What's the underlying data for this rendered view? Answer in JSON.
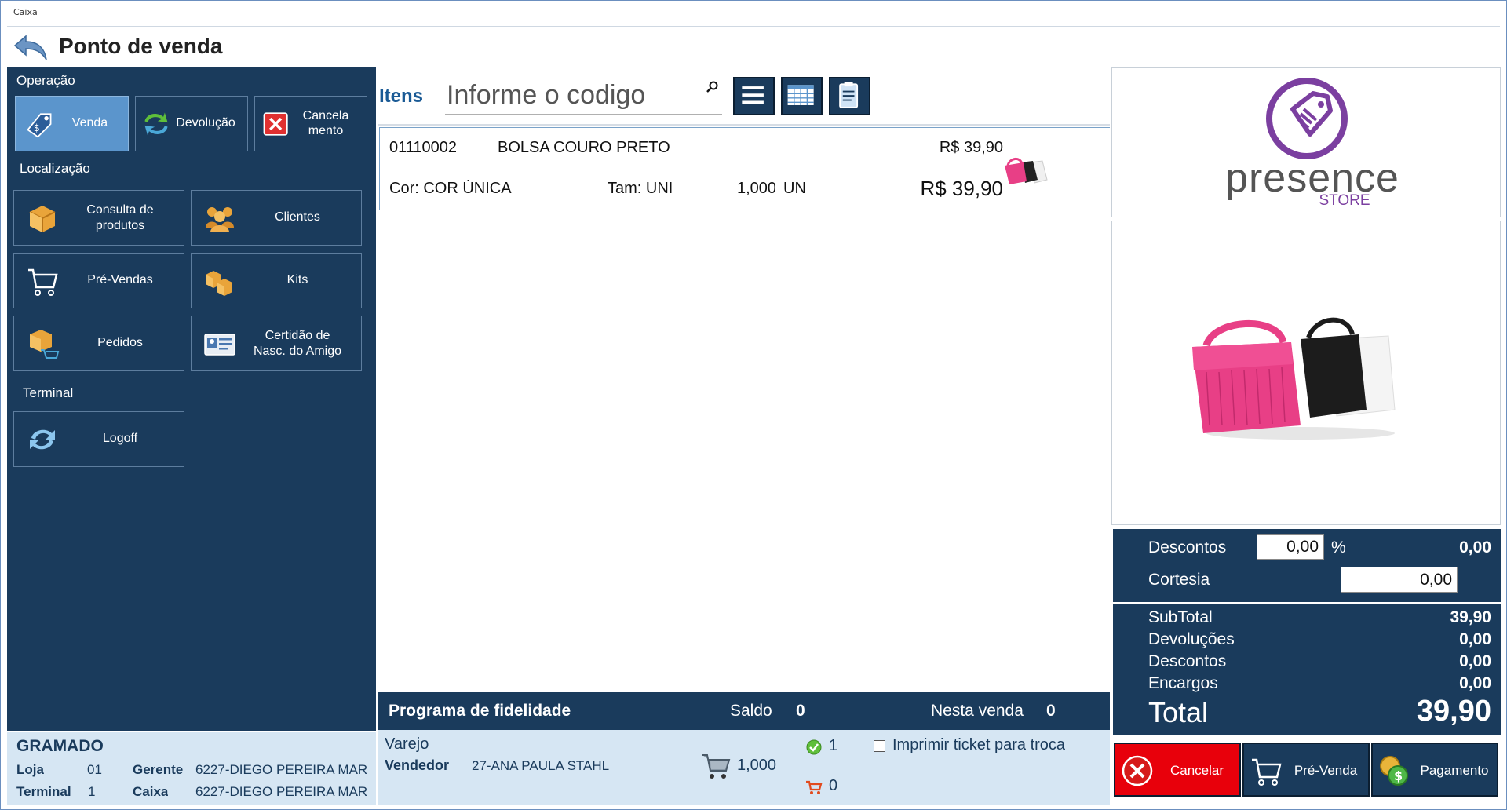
{
  "window": {
    "title": "Caixa"
  },
  "header": {
    "title": "Ponto de venda"
  },
  "left": {
    "section_operacao": "Operação",
    "btn_venda": "Venda",
    "btn_devolucao": "Devolução",
    "btn_cancelamento_l1": "Cancela",
    "btn_cancelamento_l2": "mento",
    "section_localizacao": "Localização",
    "btn_consulta_l1": "Consulta de",
    "btn_consulta_l2": "produtos",
    "btn_clientes": "Clientes",
    "btn_prevendas": "Pré-Vendas",
    "btn_kits": "Kits",
    "btn_pedidos": "Pedidos",
    "btn_certidao_l1": "Certidão de",
    "btn_certidao_l2": "Nasc. do Amigo",
    "section_terminal": "Terminal",
    "btn_logoff": "Logoff"
  },
  "store": {
    "name": "GRAMADO",
    "loja_label": "Loja",
    "loja_value": "01",
    "gerente_label": "Gerente",
    "gerente_value": "6227-DIEGO PEREIRA MAR",
    "terminal_label": "Terminal",
    "terminal_value": "1",
    "caixa_label": "Caixa",
    "caixa_value": "6227-DIEGO PEREIRA MAR"
  },
  "items": {
    "label": "Itens",
    "search_placeholder": "Informe o codigo",
    "list": [
      {
        "code": "01110002",
        "name": "BOLSA COURO PRETO",
        "unit_price": "R$ 39,90",
        "color": "Cor: COR ÚNICA",
        "size": "Tam: UNI",
        "quantity": "1,000",
        "unit": "UN",
        "total": "R$ 39,90"
      }
    ]
  },
  "fidelity": {
    "title": "Programa de fidelidade",
    "saldo_label": "Saldo",
    "saldo_value": "0",
    "nesta_label": "Nesta venda",
    "nesta_value": "0"
  },
  "sale": {
    "type": "Varejo",
    "vendedor_label": "Vendedor",
    "vendedor_value": "27-ANA PAULA STAHL",
    "cart_qty": "1,000",
    "check_count": "1",
    "cart_count": "0",
    "print_ticket_label": "Imprimir ticket para troca"
  },
  "brand": {
    "logo_main": "presence",
    "logo_sub": "STORE",
    "accent": "#7b3fa0"
  },
  "totals": {
    "descontos_label": "Descontos",
    "descontos_input": "0,00",
    "percent_sign": "%",
    "descontos_value": "0,00",
    "cortesia_label": "Cortesia",
    "cortesia_input": "0,00",
    "subtotal_label": "SubTotal",
    "subtotal_value": "39,90",
    "devolucoes_label": "Devoluções",
    "devolucoes_value": "0,00",
    "descontos2_label": "Descontos",
    "descontos2_value": "0,00",
    "encargos_label": "Encargos",
    "encargos_value": "0,00",
    "total_label": "Total",
    "total_value": "39,90"
  },
  "actions": {
    "cancelar": "Cancelar",
    "prevenda": "Pré-Venda",
    "pagamento": "Pagamento"
  },
  "colors": {
    "panel": "#1a3b5c",
    "active": "#5b95cc",
    "footer": "#d6e6f3",
    "cancel": "#e8000b"
  }
}
